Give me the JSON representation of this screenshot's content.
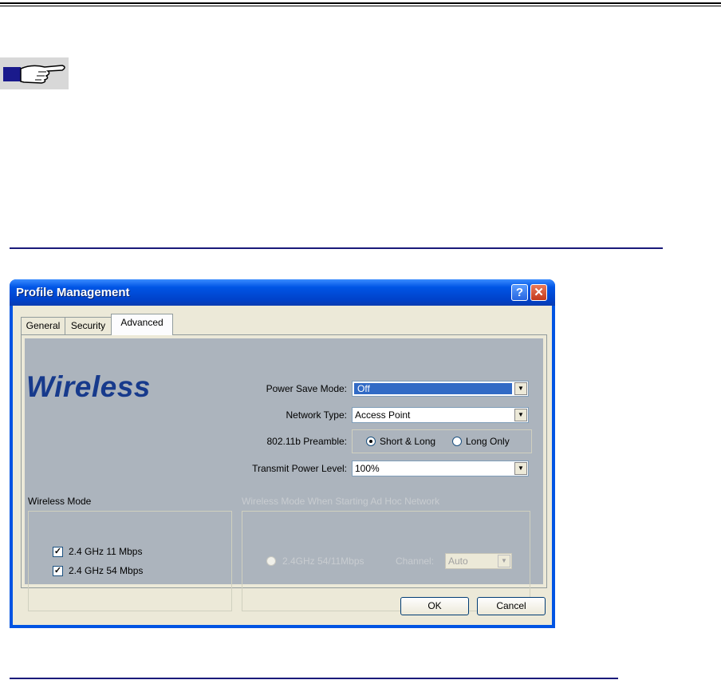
{
  "window": {
    "title": "Profile Management"
  },
  "tabs": [
    {
      "label": "General"
    },
    {
      "label": "Security"
    },
    {
      "label": "Advanced",
      "active": true
    }
  ],
  "brand": {
    "text": "Wireless"
  },
  "fields": {
    "power_save_mode": {
      "label": "Power Save Mode:",
      "value": "Off"
    },
    "network_type": {
      "label": "Network Type:",
      "value": "Access Point"
    },
    "preamble": {
      "label": "802.11b Preamble:",
      "options": [
        {
          "label": "Short & Long",
          "selected": true
        },
        {
          "label": "Long Only",
          "selected": false
        }
      ]
    },
    "transmit_power": {
      "label": "Transmit Power Level:",
      "value": "100%"
    }
  },
  "wireless_mode": {
    "title": "Wireless Mode",
    "options": [
      {
        "label": "2.4 GHz 11 Mbps",
        "checked": true
      },
      {
        "label": "2.4 GHz 54 Mbps",
        "checked": true
      }
    ]
  },
  "adhoc": {
    "title": "Wireless Mode When Starting Ad Hoc Network",
    "radio_label": "2.4GHz 54/11Mbps",
    "channel_label": "Channel:",
    "channel_value": "Auto"
  },
  "buttons": {
    "ok": "OK",
    "cancel": "Cancel"
  },
  "colors": {
    "titlebar": "#0054e3",
    "panel": "#acb4bd",
    "brand": "#173a8c",
    "highlight": "#316ac5"
  }
}
